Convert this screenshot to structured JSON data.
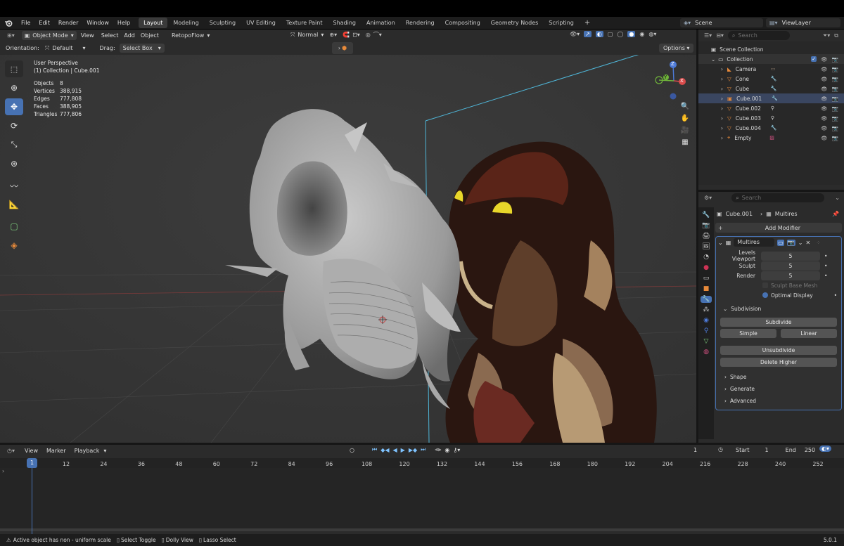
{
  "menu": {
    "file": "File",
    "edit": "Edit",
    "render": "Render",
    "window": "Window",
    "help": "Help"
  },
  "workspaces": [
    "Layout",
    "Modeling",
    "Sculpting",
    "UV Editing",
    "Texture Paint",
    "Shading",
    "Animation",
    "Rendering",
    "Compositing",
    "Geometry Nodes",
    "Scripting"
  ],
  "active_workspace": "Layout",
  "scene": {
    "name": "Scene",
    "view_layer": "ViewLayer"
  },
  "viewport": {
    "mode": "Object Mode",
    "view": "View",
    "select": "Select",
    "add": "Add",
    "object": "Object",
    "retopoflow": "RetopoFlow",
    "transform_orientation": "Normal",
    "orientation_label": "Orientation:",
    "orientation_value": "Default",
    "drag_label": "Drag:",
    "drag_value": "Select Box",
    "options": "Options",
    "perspective": "User Perspective",
    "collection_line": "(1) Collection | Cube.001",
    "stats": [
      {
        "label": "Objects",
        "value": "8"
      },
      {
        "label": "Vertices",
        "value": "388,915"
      },
      {
        "label": "Edges",
        "value": "777,808"
      },
      {
        "label": "Faces",
        "value": "388,905"
      },
      {
        "label": "Triangles",
        "value": "777,806"
      }
    ],
    "gizmo": {
      "z": "Z",
      "x": "X",
      "y": "Y"
    }
  },
  "outliner": {
    "search_placeholder": "Search",
    "scene_collection": "Scene Collection",
    "collection": "Collection",
    "items": [
      "Camera",
      "Cone",
      "Cube",
      "Cube.001",
      "Cube.002",
      "Cube.003",
      "Cube.004",
      "Empty"
    ]
  },
  "properties": {
    "search_placeholder": "Search",
    "object": "Cube.001",
    "modifier_tab": "Multires",
    "add_modifier": "Add Modifier",
    "modifier_name": "Multires",
    "levels": [
      {
        "label": "Levels Viewport",
        "value": "5"
      },
      {
        "label": "Sculpt",
        "value": "5"
      },
      {
        "label": "Render",
        "value": "5"
      }
    ],
    "sculpt_base_mesh": "Sculpt Base Mesh",
    "optimal_display": "Optimal Display",
    "subdivision": "Subdivision",
    "subdivide": "Subdivide",
    "simple": "Simple",
    "linear": "Linear",
    "unsubdivide": "Unsubdivide",
    "delete_higher": "Delete Higher",
    "shape": "Shape",
    "generate": "Generate",
    "advanced": "Advanced"
  },
  "timeline": {
    "view": "View",
    "marker": "Marker",
    "playback": "Playback",
    "current_frame": "1",
    "start_label": "Start",
    "start": "1",
    "end_label": "End",
    "end": "250",
    "ticks": [
      "1",
      "12",
      "24",
      "36",
      "48",
      "60",
      "72",
      "84",
      "96",
      "108",
      "120",
      "132",
      "144",
      "156",
      "168",
      "180",
      "192",
      "204",
      "216",
      "228",
      "240",
      "252"
    ]
  },
  "statusbar": {
    "warning": "Active object has non - uniform scale",
    "hint1": "Select Toggle",
    "hint2": "Dolly View",
    "hint3": "Lasso Select",
    "version": "5.0.1"
  }
}
